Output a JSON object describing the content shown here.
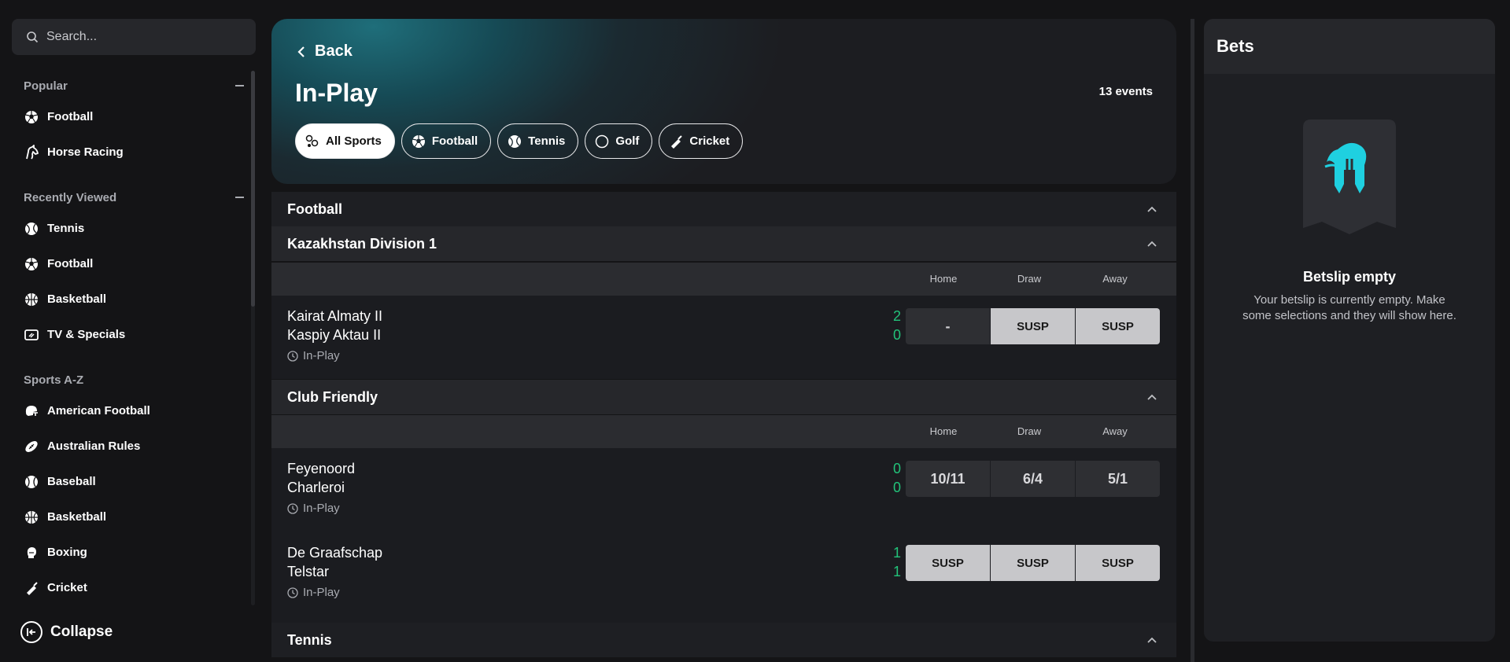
{
  "sidebar": {
    "search_placeholder": "Search...",
    "sections": {
      "popular": {
        "title": "Popular",
        "items": [
          "Football",
          "Horse Racing"
        ]
      },
      "recently_viewed": {
        "title": "Recently Viewed",
        "items": [
          "Tennis",
          "Football",
          "Basketball",
          "TV & Specials"
        ]
      },
      "sports_az": {
        "title": "Sports A-Z",
        "items": [
          "American Football",
          "Australian Rules",
          "Baseball",
          "Basketball",
          "Boxing",
          "Cricket"
        ]
      }
    },
    "collapse_label": "Collapse"
  },
  "header": {
    "back_label": "Back",
    "title": "In-Play",
    "events_count": "13 events",
    "filters": [
      {
        "label": "All Sports",
        "icon": "all-sports-icon",
        "active": true
      },
      {
        "label": "Football",
        "icon": "football-icon",
        "active": false
      },
      {
        "label": "Tennis",
        "icon": "tennis-icon",
        "active": false
      },
      {
        "label": "Golf",
        "icon": "golf-icon",
        "active": false
      },
      {
        "label": "Cricket",
        "icon": "cricket-icon",
        "active": false
      }
    ]
  },
  "market_columns": {
    "home": "Home",
    "draw": "Draw",
    "away": "Away"
  },
  "sports": {
    "football": {
      "title": "Football",
      "leagues": [
        {
          "title": "Kazakhstan Division 1",
          "matches": [
            {
              "home": "Kairat Almaty II",
              "away": "Kaspiy Aktau II",
              "home_score": "2",
              "away_score": "0",
              "status": "In-Play",
              "odds": [
                "-",
                "SUSP",
                "SUSP"
              ]
            }
          ]
        },
        {
          "title": "Club Friendly",
          "matches": [
            {
              "home": "Feyenoord",
              "away": "Charleroi",
              "home_score": "0",
              "away_score": "0",
              "status": "In-Play",
              "odds": [
                "10/11",
                "6/4",
                "5/1"
              ]
            },
            {
              "home": "De Graafschap",
              "away": "Telstar",
              "home_score": "1",
              "away_score": "1",
              "status": "In-Play",
              "odds": [
                "SUSP",
                "SUSP",
                "SUSP"
              ]
            }
          ]
        }
      ]
    },
    "tennis": {
      "title": "Tennis"
    }
  },
  "betslip": {
    "title": "Bets",
    "empty_title": "Betslip empty",
    "empty_text": "Your betslip is currently empty. Make some selections and they will show here."
  },
  "colors": {
    "accent": "#1fd0e0",
    "score": "#22c37a",
    "suspended": "#c7c7ca"
  }
}
